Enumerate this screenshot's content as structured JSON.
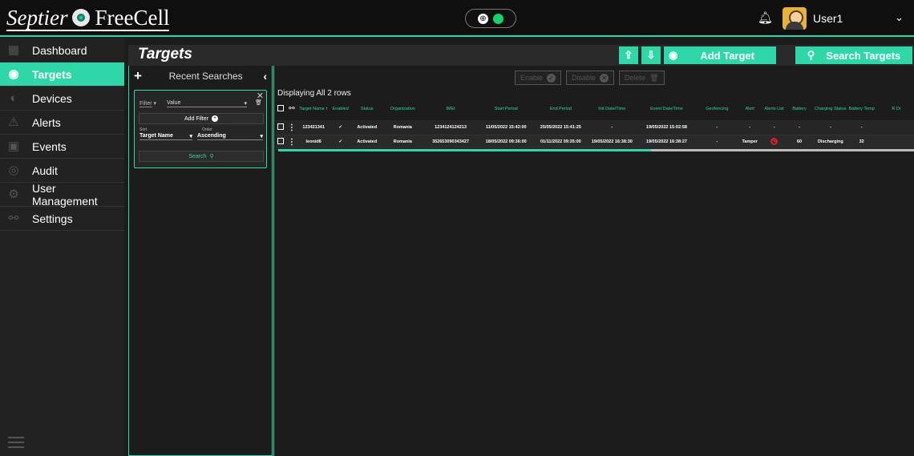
{
  "header": {
    "brand_part1": "Septier",
    "brand_part2": "FreeCell",
    "username": "User1"
  },
  "sidebar": {
    "items": [
      {
        "label": "Dashboard",
        "icon": "dashboard-icon"
      },
      {
        "label": "Targets",
        "icon": "target-icon",
        "active": true
      },
      {
        "label": "Devices",
        "icon": "device-icon"
      },
      {
        "label": "Alerts",
        "icon": "alert-icon"
      },
      {
        "label": "Events",
        "icon": "event-icon"
      },
      {
        "label": "Audit",
        "icon": "audit-icon"
      },
      {
        "label": "User Management",
        "icon": "users-icon"
      },
      {
        "label": "Settings",
        "icon": "settings-icon"
      }
    ]
  },
  "titlebar": {
    "title": "Targets",
    "add_target": "Add Target",
    "search_targets": "Search Targets"
  },
  "search_panel": {
    "title": "Recent Searches",
    "filter_label": "Filter",
    "value_label": "Value",
    "add_filter": "Add Filter",
    "sort_label": "Sort",
    "order_label": "Order",
    "sort_value": "Target Name",
    "order_value": "Ascending",
    "search_button": "Search"
  },
  "main": {
    "enable": "Enable",
    "disable": "Disable",
    "delete": "Delete",
    "displaying": "Displaying All 2 rows",
    "columns": [
      "Target Name",
      "Enabled",
      "Status",
      "Organization",
      "IMEI",
      "Start Period",
      "End Period",
      "Init Date/Time",
      "Event Date/Time",
      "Geofencing",
      "Alert",
      "Alerts List",
      "Battery",
      "Charging Status",
      "Battery Temp",
      "R Di"
    ],
    "rows": [
      {
        "target_name": "123421341",
        "enabled": "✓",
        "status": "Activated",
        "organization": "Romania",
        "imei": "1234124124213",
        "start_period": "11/05/2022 15:42:00",
        "end_period": "25/05/2022 15:41:25",
        "init_date": "-",
        "event_date": "19/05/2022 15:02:58",
        "geofencing": "-",
        "alert": "-",
        "alerts_list": "-",
        "battery": "-",
        "charging_status": "-",
        "battery_temp": "-"
      },
      {
        "target_name": "leonid6",
        "enabled": "✓",
        "status": "Activated",
        "organization": "Romania",
        "imei": "352653090343427",
        "start_period": "18/05/2022 09:36:00",
        "end_period": "01/11/2022 09:35:00",
        "init_date": "19/05/2022 16:38:30",
        "event_date": "19/05/2022 16:38:27",
        "geofencing": "-",
        "alert": "Tamper",
        "alerts_list": "",
        "battery": "60",
        "charging_status": "Discharging",
        "battery_temp": "32"
      }
    ]
  },
  "colors": {
    "accent": "#2fd6a8",
    "danger": "#d8222a",
    "online": "#17d26a"
  }
}
